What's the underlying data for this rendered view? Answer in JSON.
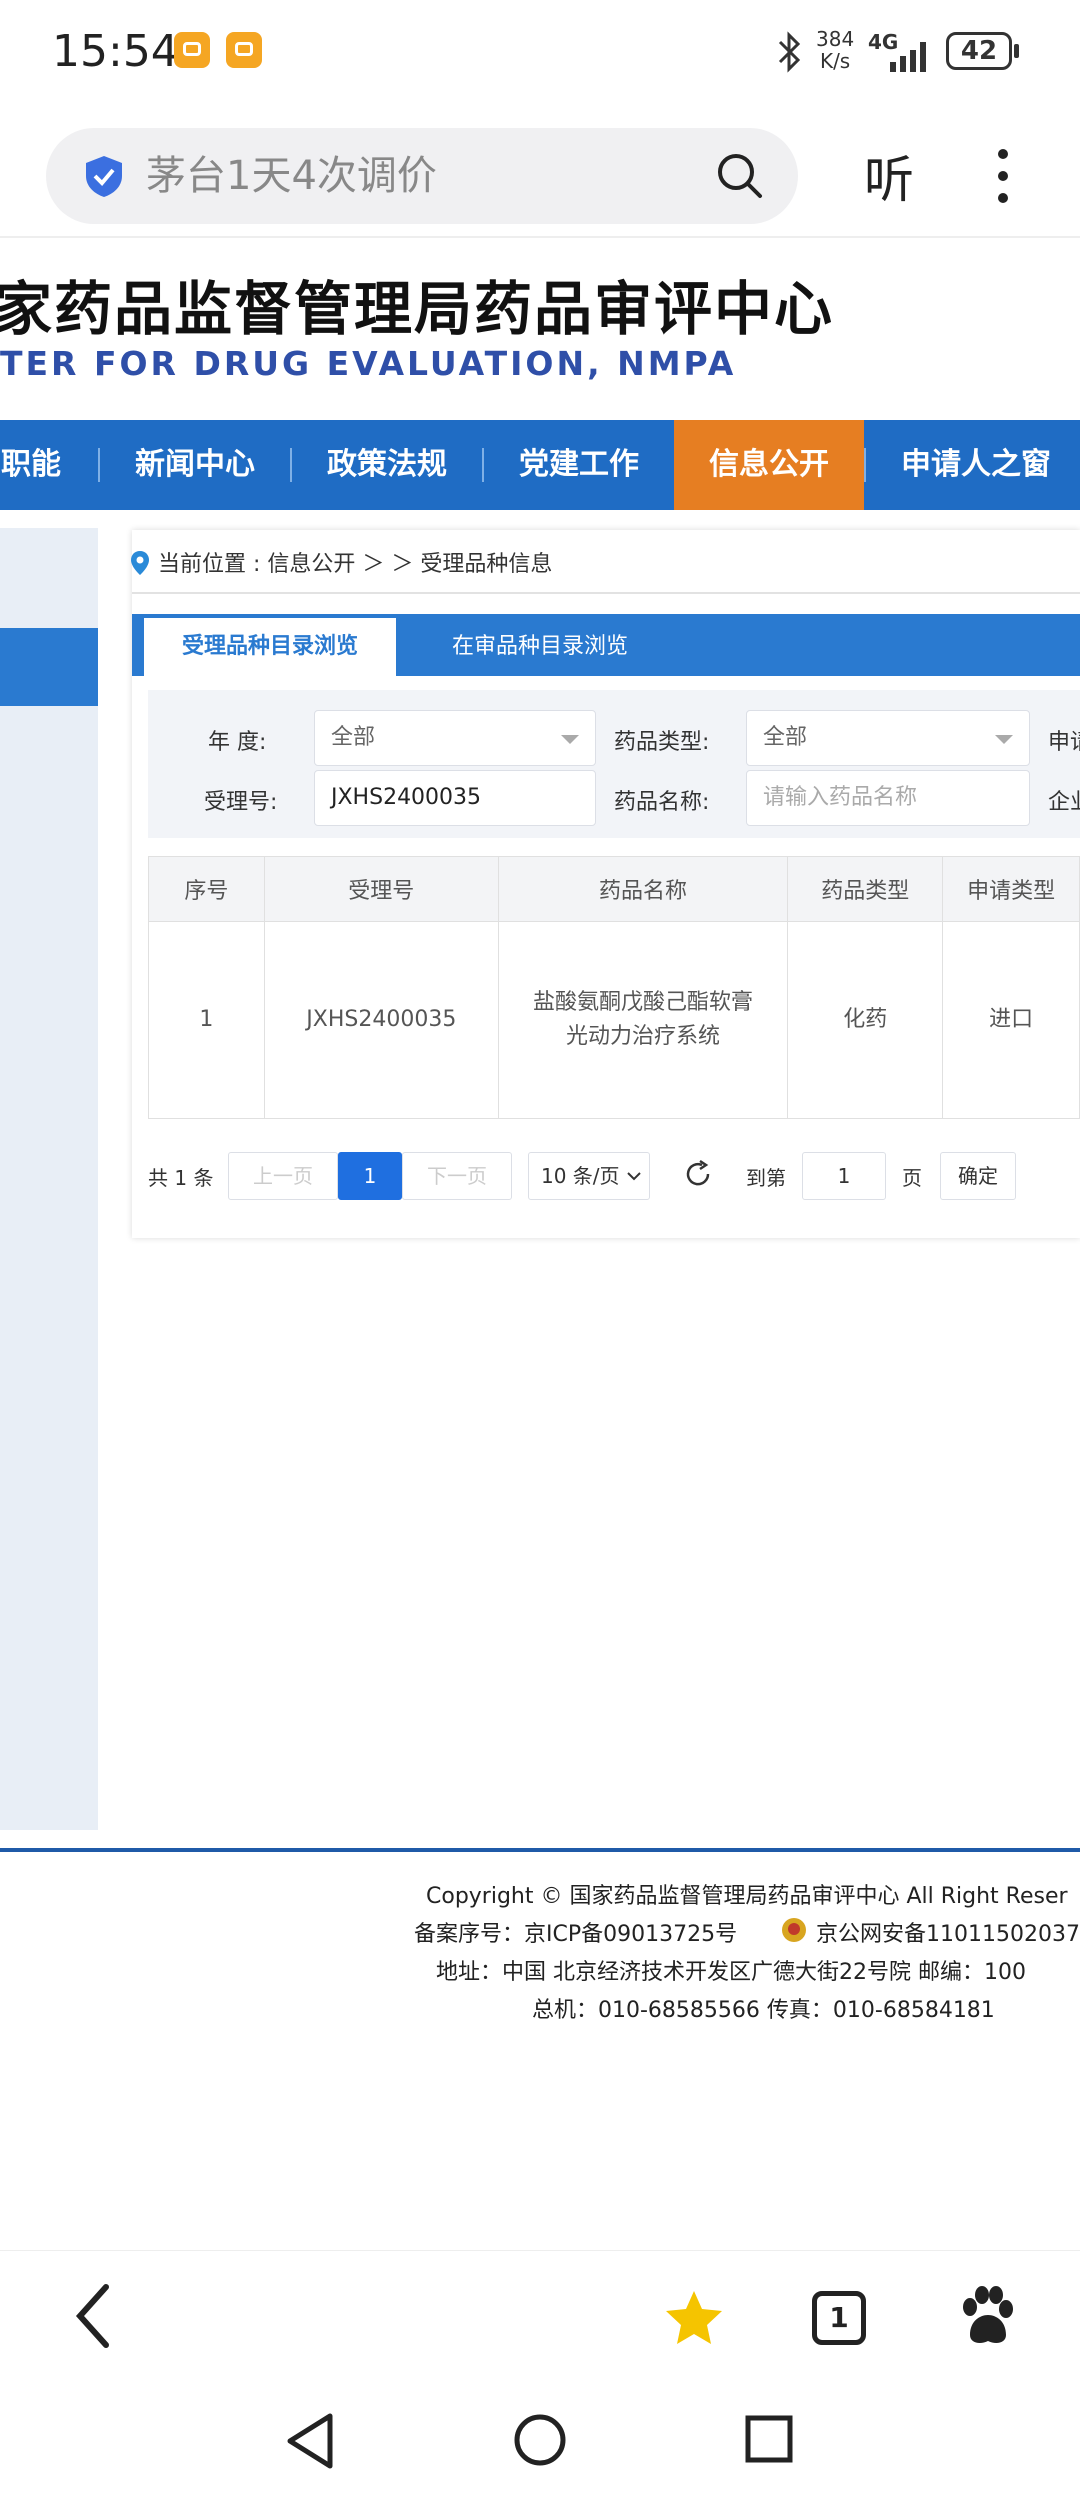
{
  "status_bar": {
    "time": "15:54",
    "speed_value": "384",
    "speed_unit": "K/s",
    "network": "4G",
    "battery": "42"
  },
  "search": {
    "query": "茅台1天4次调价",
    "listen_label": "听"
  },
  "site": {
    "title_cn": "家药品监督管理局药品审评中心",
    "title_en": "TER FOR DRUG EVALUATION, NMPA"
  },
  "nav": {
    "items": [
      "职能",
      "新闻中心",
      "政策法规",
      "党建工作",
      "信息公开",
      "申请人之窗"
    ],
    "active_index": 4
  },
  "breadcrumb": {
    "text": "当前位置 : 信息公开  ＞ ＞  受理品种信息"
  },
  "tabs": {
    "active": "受理品种目录浏览",
    "other": "在审品种目录浏览"
  },
  "filters": {
    "year_label": "年    度:",
    "year_value": "全部",
    "drug_type_label": "药品类型:",
    "drug_type_value": "全部",
    "apply_label_partial": "申请",
    "accept_no_label": "受理号:",
    "accept_no_value": "JXHS2400035",
    "drug_name_label": "药品名称:",
    "drug_name_placeholder": "请输入药品名称",
    "company_label_partial": "企业"
  },
  "table": {
    "headers": [
      "序号",
      "受理号",
      "药品名称",
      "药品类型",
      "申请类型"
    ],
    "rows": [
      {
        "index": "1",
        "accept_no": "JXHS2400035",
        "drug_name_line1": "盐酸氨酮戊酸己酯软膏",
        "drug_name_line2": "光动力治疗系统",
        "drug_type": "化药",
        "apply_type": "进口"
      }
    ]
  },
  "pagination": {
    "total": "共 1 条",
    "prev": "上一页",
    "current": "1",
    "next": "下一页",
    "page_size": "10 条/页",
    "goto_label": "到第",
    "goto_value": "1",
    "page_label": "页",
    "confirm": "确定"
  },
  "footer": {
    "copyright": "Copyright © 国家药品监督管理局药品审评中心   All Right Reser",
    "icp": "备案序号：京ICP备09013725号",
    "police": "京公网安备11011502037",
    "address": "地址：中国 北京经济技术开发区广德大街22号院      邮编：100",
    "phone": "总机：010-68585566      传真：010-68584181"
  },
  "browser_bar": {
    "tab_count": "1"
  },
  "colors": {
    "nav_blue": "#1f6cc4",
    "nav_active": "#e67e22",
    "accent_blue": "#2a7ad0",
    "star_yellow": "#f5c400"
  }
}
